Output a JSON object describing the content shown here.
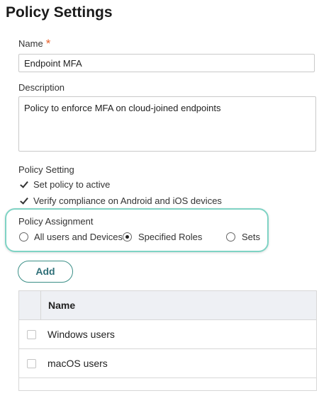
{
  "page": {
    "title": "Policy Settings"
  },
  "form": {
    "name_label": "Name",
    "required_mark": "*",
    "name_value": "Endpoint MFA",
    "description_label": "Description",
    "description_value": "Policy to enforce MFA on cloud-joined endpoints",
    "policy_setting_label": "Policy Setting",
    "checkboxes": [
      {
        "label": "Set policy to active",
        "checked": true
      },
      {
        "label": "Verify compliance on Android and iOS devices",
        "checked": true
      }
    ],
    "assignment_label": "Policy Assignment",
    "radios": [
      {
        "label": "All users and Devices",
        "selected": false
      },
      {
        "label": "Specified Roles",
        "selected": true
      },
      {
        "label": "Sets",
        "selected": false
      }
    ]
  },
  "add_button": "Add",
  "table": {
    "header": "Name",
    "rows": [
      "Windows users",
      "macOS users"
    ]
  },
  "colors": {
    "accent": "#7fd3c4",
    "required": "#e8622c",
    "button_text": "#2f6f78"
  }
}
